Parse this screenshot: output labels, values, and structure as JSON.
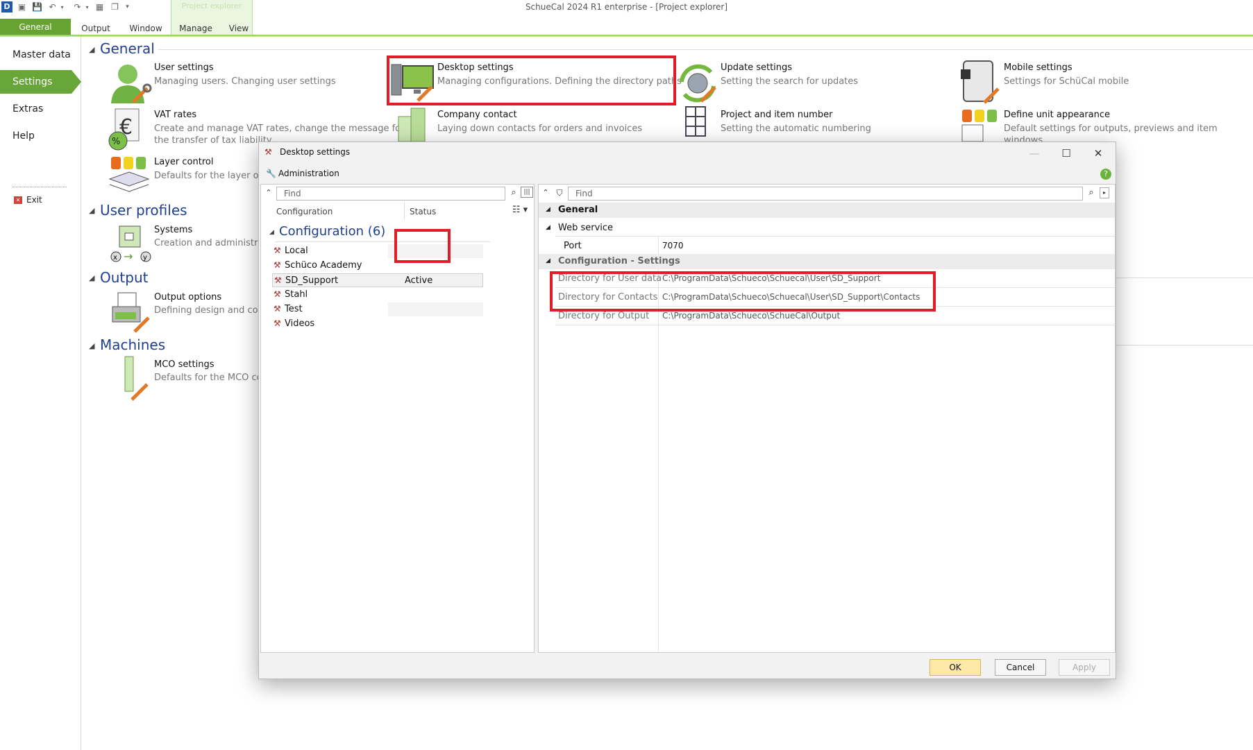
{
  "app": {
    "title": "SchueCal 2024 R1 enterprise - [Project explorer]",
    "context_tab": "Project explorer"
  },
  "ribbon": {
    "tabs": [
      "General",
      "Output",
      "Window",
      "Manage",
      "View"
    ]
  },
  "leftnav": {
    "items": [
      "Master data",
      "Settings",
      "Extras",
      "Help"
    ],
    "exit": "Exit"
  },
  "sections": {
    "general": "General",
    "user_profiles": "User profiles",
    "output": "Output",
    "machines": "Machines"
  },
  "items": {
    "user_settings": {
      "title": "User settings",
      "desc": "Managing users. Changing user settings"
    },
    "desktop_settings": {
      "title": "Desktop settings",
      "desc": "Managing configurations. Defining the directory paths"
    },
    "update_settings": {
      "title": "Update settings",
      "desc": "Setting the search for updates"
    },
    "mobile_settings": {
      "title": "Mobile settings",
      "desc": "Settings for SchüCal mobile"
    },
    "vat_rates": {
      "title": "VAT rates",
      "desc1": "Create and manage VAT rates, change the message for",
      "desc2": "the transfer of tax liability"
    },
    "company_contact": {
      "title": "Company contact",
      "desc": "Laying down contacts for orders and invoices"
    },
    "project_number": {
      "title": "Project and item number",
      "desc": "Setting the automatic numbering"
    },
    "unit_appearance": {
      "title": "Define unit appearance",
      "desc": "Default settings for outputs, previews and item windows"
    },
    "layer_control": {
      "title": "Layer control",
      "desc": "Defaults for the layer of th"
    },
    "systems": {
      "title": "Systems",
      "desc": "Creation and administratio"
    },
    "output_options": {
      "title": "Output options",
      "desc": "Defining design and conte"
    },
    "mco_settings": {
      "title": "MCO settings",
      "desc": "Defaults for the MCO cont"
    }
  },
  "dialog": {
    "title": "Desktop settings",
    "toolbar_label": "Administration",
    "left": {
      "find_placeholder": "Find",
      "col_config": "Configuration",
      "col_status": "Status",
      "group": "Configuration (6)",
      "rows": [
        {
          "name": "Local",
          "status": ""
        },
        {
          "name": "Schüco Academy",
          "status": ""
        },
        {
          "name": "SD_Support",
          "status": "Active"
        },
        {
          "name": "Stahl",
          "status": ""
        },
        {
          "name": "Test",
          "status": ""
        },
        {
          "name": "Videos",
          "status": ""
        }
      ]
    },
    "right": {
      "find_placeholder": "Find",
      "cat_general": "General",
      "sub_webservice": "Web service",
      "port_label": "Port",
      "port_value": "7070",
      "cat_config": "Configuration - Settings",
      "dir_user_label": "Directory for User data",
      "dir_user_value": "C:\\ProgramData\\Schueco\\Schuecal\\User\\SD_Support",
      "dir_contacts_label": "Directory for Contacts",
      "dir_contacts_value": "C:\\ProgramData\\Schueco\\Schuecal\\User\\SD_Support\\Contacts",
      "dir_output_label": "Directory for Output",
      "dir_output_value": "C:\\ProgramData\\Schueco\\SchueCal\\Output"
    },
    "buttons": {
      "ok": "OK",
      "cancel": "Cancel",
      "apply": "Apply"
    }
  },
  "colors": {
    "accent_green": "#68a63a",
    "section_blue": "#1f3f8f",
    "highlight_red": "#e11d2a"
  }
}
